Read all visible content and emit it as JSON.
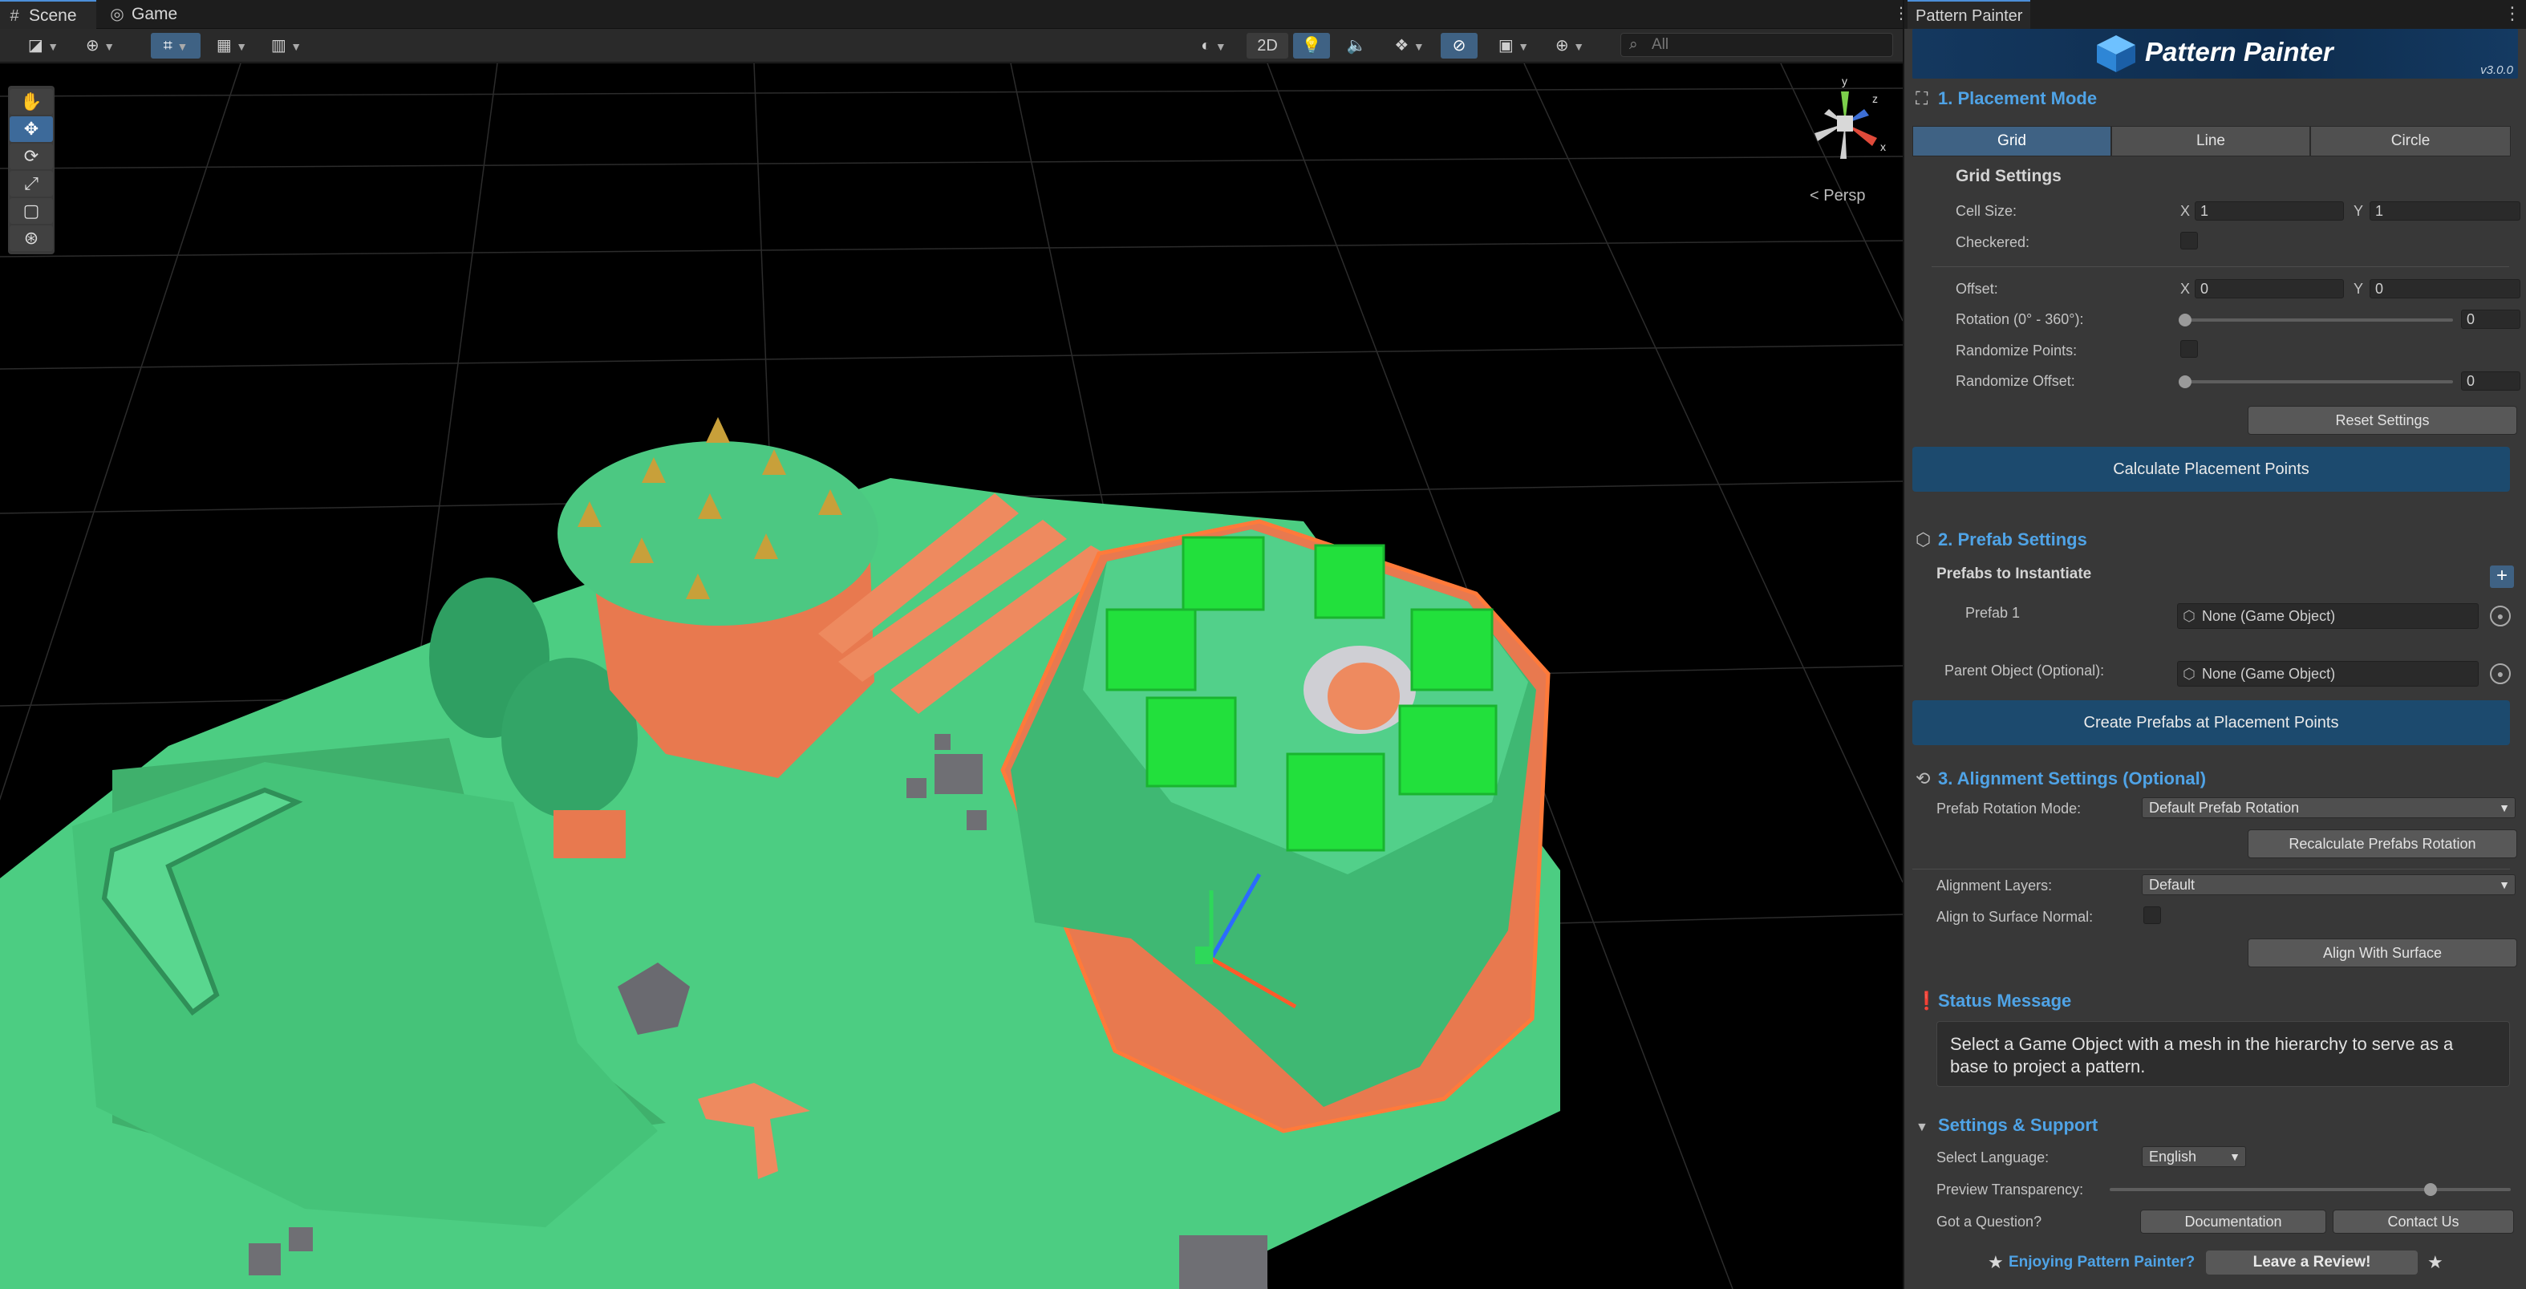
{
  "scene_window": {
    "tabs": [
      {
        "label": "Scene",
        "icon": "grid-icon"
      },
      {
        "label": "Game",
        "icon": "gamepad-icon"
      }
    ],
    "toolbar": {
      "mode_2d": "2D",
      "search_placeholder": "All"
    },
    "view_label": "< Persp",
    "gizmo_axes": {
      "x": "x",
      "y": "y",
      "z": "z"
    }
  },
  "panel": {
    "tab_label": "Pattern Painter",
    "banner_title": "Pattern Painter",
    "version": "v3.0.0",
    "placement": {
      "title": "1. Placement Mode",
      "modes": [
        "Grid",
        "Line",
        "Circle"
      ],
      "selected_mode": "Grid",
      "grid_settings_title": "Grid Settings",
      "cell_size_label": "Cell Size:",
      "cell_size": {
        "x": "1",
        "y": "1"
      },
      "checkered_label": "Checkered:",
      "offset_label": "Offset:",
      "offset": {
        "x": "0",
        "y": "0"
      },
      "rotation_label": "Rotation (0° - 360°):",
      "rotation_value": "0",
      "randomize_points_label": "Randomize Points:",
      "randomize_offset_label": "Randomize Offset:",
      "randomize_offset_value": "0",
      "reset_button": "Reset Settings",
      "calculate_button": "Calculate Placement Points",
      "axis_x": "X",
      "axis_y": "Y"
    },
    "prefab": {
      "title": "2. Prefab Settings",
      "prefabs_title": "Prefabs to Instantiate",
      "prefab_1_label": "Prefab 1",
      "prefab_1_value": "None (Game Object)",
      "parent_label": "Parent Object (Optional):",
      "parent_value": "None (Game Object)",
      "create_button": "Create Prefabs at Placement Points",
      "add_symbol": "+"
    },
    "alignment": {
      "title": "3. Alignment Settings (Optional)",
      "rotation_mode_label": "Prefab Rotation Mode:",
      "rotation_mode_value": "Default Prefab Rotation",
      "recalculate_button": "Recalculate Prefabs Rotation",
      "layers_label": "Alignment Layers:",
      "layers_value": "Default",
      "align_normal_label": "Align to Surface Normal:",
      "align_button": "Align With Surface"
    },
    "status": {
      "title": "Status Message",
      "message": "Select a Game Object with a mesh in the hierarchy to serve as a base to project a pattern."
    },
    "settings": {
      "title": "Settings & Support",
      "language_label": "Select Language:",
      "language_value": "English",
      "transparency_label": "Preview Transparency:",
      "transparency_value": 0.8,
      "question_label": "Got a Question?",
      "documentation_button": "Documentation",
      "contact_button": "Contact Us"
    },
    "footer": {
      "text": "Enjoying Pattern Painter?",
      "review_button": "Leave a Review!"
    }
  },
  "colors": {
    "accent": "#4fa3e6",
    "selected": "#3f6284",
    "primary_button": "#1c4a6e",
    "ground": "#4ccd82",
    "cliff": "#e8794f",
    "preview_box": "#22e03c"
  }
}
